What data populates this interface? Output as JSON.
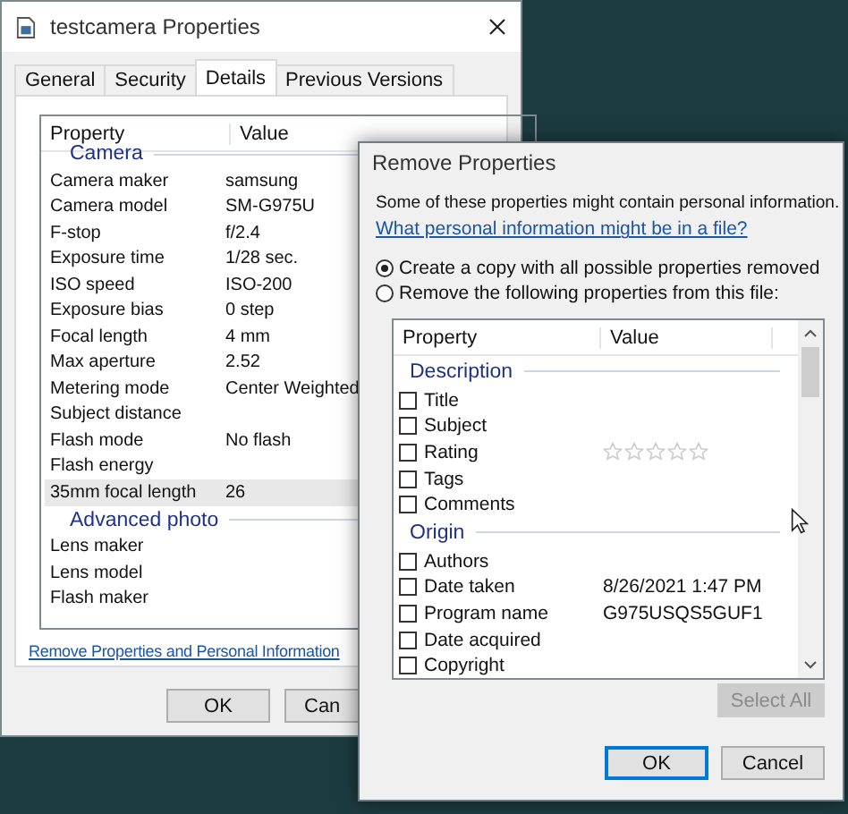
{
  "properties_window": {
    "title": "testcamera Properties",
    "tabs": [
      {
        "label": "General",
        "selected": false
      },
      {
        "label": "Security",
        "selected": false
      },
      {
        "label": "Details",
        "selected": true
      },
      {
        "label": "Previous Versions",
        "selected": false
      }
    ],
    "columns": [
      "Property",
      "Value"
    ],
    "rows": [
      {
        "kind": "group",
        "label": "Camera"
      },
      {
        "kind": "row",
        "label": "Camera maker",
        "value": "samsung",
        "selected": false
      },
      {
        "kind": "row",
        "label": "Camera model",
        "value": "SM-G975U",
        "selected": false
      },
      {
        "kind": "row",
        "label": "F-stop",
        "value": "f/2.4",
        "selected": false
      },
      {
        "kind": "row",
        "label": "Exposure time",
        "value": "1/28 sec.",
        "selected": false
      },
      {
        "kind": "row",
        "label": "ISO speed",
        "value": "ISO-200",
        "selected": false
      },
      {
        "kind": "row",
        "label": "Exposure bias",
        "value": "0 step",
        "selected": false
      },
      {
        "kind": "row",
        "label": "Focal length",
        "value": "4 mm",
        "selected": false
      },
      {
        "kind": "row",
        "label": "Max aperture",
        "value": "2.52",
        "selected": false
      },
      {
        "kind": "row",
        "label": "Metering mode",
        "value": "Center Weighted",
        "selected": false
      },
      {
        "kind": "row",
        "label": "Subject distance",
        "selected": false
      },
      {
        "kind": "row",
        "label": "Flash mode",
        "value": "No flash",
        "selected": false
      },
      {
        "kind": "row",
        "label": "Flash energy",
        "selected": false
      },
      {
        "kind": "row",
        "label": "35mm focal length",
        "value": "26",
        "selected": true
      },
      {
        "kind": "group",
        "label": "Advanced photo"
      },
      {
        "kind": "row",
        "label": "Lens maker",
        "selected": false
      },
      {
        "kind": "row",
        "label": "Lens model",
        "selected": false
      },
      {
        "kind": "row",
        "label": "Flash maker",
        "selected": false
      }
    ],
    "link": "Remove Properties and Personal Information",
    "buttons": [
      "OK",
      "Can"
    ]
  },
  "remove_dialog": {
    "title": "Remove Properties",
    "intro": "Some of these properties might contain personal information.",
    "link": "What personal information might be in a file?",
    "options": [
      {
        "label": "Create a copy with all possible properties removed",
        "selected": true
      },
      {
        "label": "Remove the following properties from this file:",
        "selected": false
      }
    ],
    "columns": [
      "Property",
      "Value"
    ],
    "rows": [
      {
        "kind": "group",
        "label": "Description"
      },
      {
        "kind": "check",
        "label": "Title",
        "checked": false
      },
      {
        "kind": "check",
        "label": "Subject",
        "checked": false
      },
      {
        "kind": "rating",
        "label": "Rating",
        "checked": false,
        "stars": 0
      },
      {
        "kind": "check",
        "label": "Tags",
        "checked": false
      },
      {
        "kind": "check",
        "label": "Comments",
        "checked": false
      },
      {
        "kind": "group",
        "label": "Origin"
      },
      {
        "kind": "check",
        "label": "Authors",
        "checked": false
      },
      {
        "kind": "check",
        "label": "Date taken",
        "value": "8/26/2021 1:47 PM",
        "checked": false
      },
      {
        "kind": "check",
        "label": "Program name",
        "value": "G975USQS5GUF1",
        "checked": false
      },
      {
        "kind": "check",
        "label": "Date acquired",
        "checked": false
      },
      {
        "kind": "check",
        "label": "Copyright",
        "checked": false
      }
    ],
    "select_all": {
      "label": "Select All",
      "disabled": true
    },
    "buttons": [
      {
        "label": "OK",
        "selected": true
      },
      {
        "label": "Cancel",
        "selected": false
      }
    ]
  }
}
